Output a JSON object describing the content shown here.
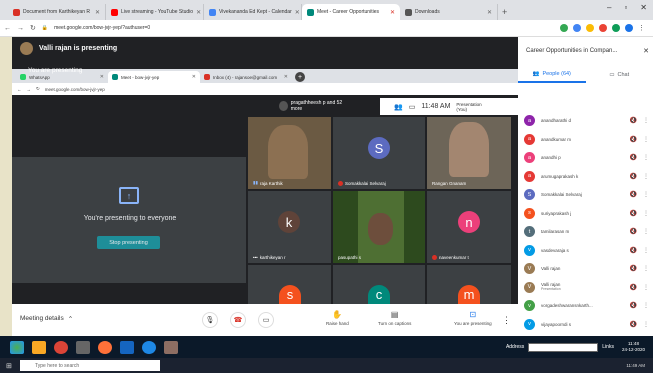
{
  "outer_tabs": [
    {
      "label": "Document from Karthikeyan R",
      "color": "#d93025"
    },
    {
      "label": "Live streaming - YouTube Studio",
      "color": "#ff0000"
    },
    {
      "label": "Vivekananda Ed Kept - Calendar",
      "color": "#4285f4"
    },
    {
      "label": "Meet - Career Opportunities",
      "color": "#00897b",
      "active": true
    },
    {
      "label": "Downloads",
      "color": "#555"
    }
  ],
  "outer_url": "meet.google.com/bow-jvjr-yep/?authuser=0",
  "presenter_banner": "Valli rajan is presenting",
  "inner_tabs": [
    {
      "label": "WhatsApp",
      "color": "#25d366"
    },
    {
      "label": "Meet - bow-jvjr-yep",
      "color": "#00897b",
      "active": true
    },
    {
      "label": "Inbox (4) - rajansoe@gmail.com",
      "color": "#d93025"
    }
  ],
  "inner_url": "meet.google.com/bow-jvjr-yep",
  "you_presenting": "You are presenting",
  "presenting_to_everyone": "You're presenting to everyone",
  "stop_presenting": "Stop presenting",
  "top_pill": "pragathheesh p and 52 more",
  "inner_time": "11:48 AM",
  "presentation_label": "Presentation (You)",
  "tiles": [
    {
      "name": "raja Karthik",
      "kind": "video"
    },
    {
      "name": "Somakkalai Selvaraj",
      "letter": "S",
      "color": "#5c6bc0"
    },
    {
      "name": "Rangan Gnanam",
      "kind": "video"
    },
    {
      "name": "karthikeyan r",
      "letter": "k",
      "color": "#5f4339"
    },
    {
      "name": "pasupathi s",
      "kind": "video"
    },
    {
      "name": "naveenkumar t",
      "letter": "n",
      "color": "#ec407a"
    },
    {
      "letter": "s",
      "color": "#f4511e"
    },
    {
      "letter": "c",
      "color": "#00897b"
    },
    {
      "letter": "m",
      "color": "#f4511e"
    }
  ],
  "bottom": {
    "meeting_details": "Meeting details",
    "raise_hand": "Raise hand",
    "captions": "Turn on captions",
    "presenting": "You are presenting"
  },
  "side": {
    "title": "Career Opportunities in Compan...",
    "people_tab": "People (64)",
    "chat_tab": "Chat",
    "people": [
      {
        "name": "anandharathi d",
        "letter": "a",
        "color": "#8e24aa"
      },
      {
        "name": "anandkumar m",
        "letter": "a",
        "color": "#e53935"
      },
      {
        "name": "anandhi p",
        "letter": "a",
        "color": "#ec407a"
      },
      {
        "name": "arumugaprakash k",
        "letter": "a",
        "color": "#e53935"
      },
      {
        "name": "Somakkalai Selvaraj",
        "letter": "S",
        "color": "#5c6bc0"
      },
      {
        "name": "suriyaprakash j",
        "letter": "s",
        "color": "#f4511e"
      },
      {
        "name": "tamilarasan m",
        "letter": "t",
        "color": "#546e7a"
      },
      {
        "name": "vasdevaraja s",
        "letter": "v",
        "color": "#039be5"
      },
      {
        "name": "Valli rajan",
        "letter": "V",
        "color": "#9a7b54"
      },
      {
        "name": "Valli rajan",
        "sub": "Presentation",
        "letter": "V",
        "color": "#9a7b54"
      },
      {
        "name": "vorgadeshwaransnkarth...",
        "letter": "v",
        "color": "#43a047"
      },
      {
        "name": "vijayapoorndi s",
        "letter": "v",
        "color": "#039be5"
      }
    ]
  },
  "taskbar": {
    "address": "Address",
    "links": "Links",
    "clock_time": "11:48",
    "clock_date": "24-12-2020",
    "search_placeholder": "Type here to search",
    "bottom_time": "11:49 AM"
  }
}
